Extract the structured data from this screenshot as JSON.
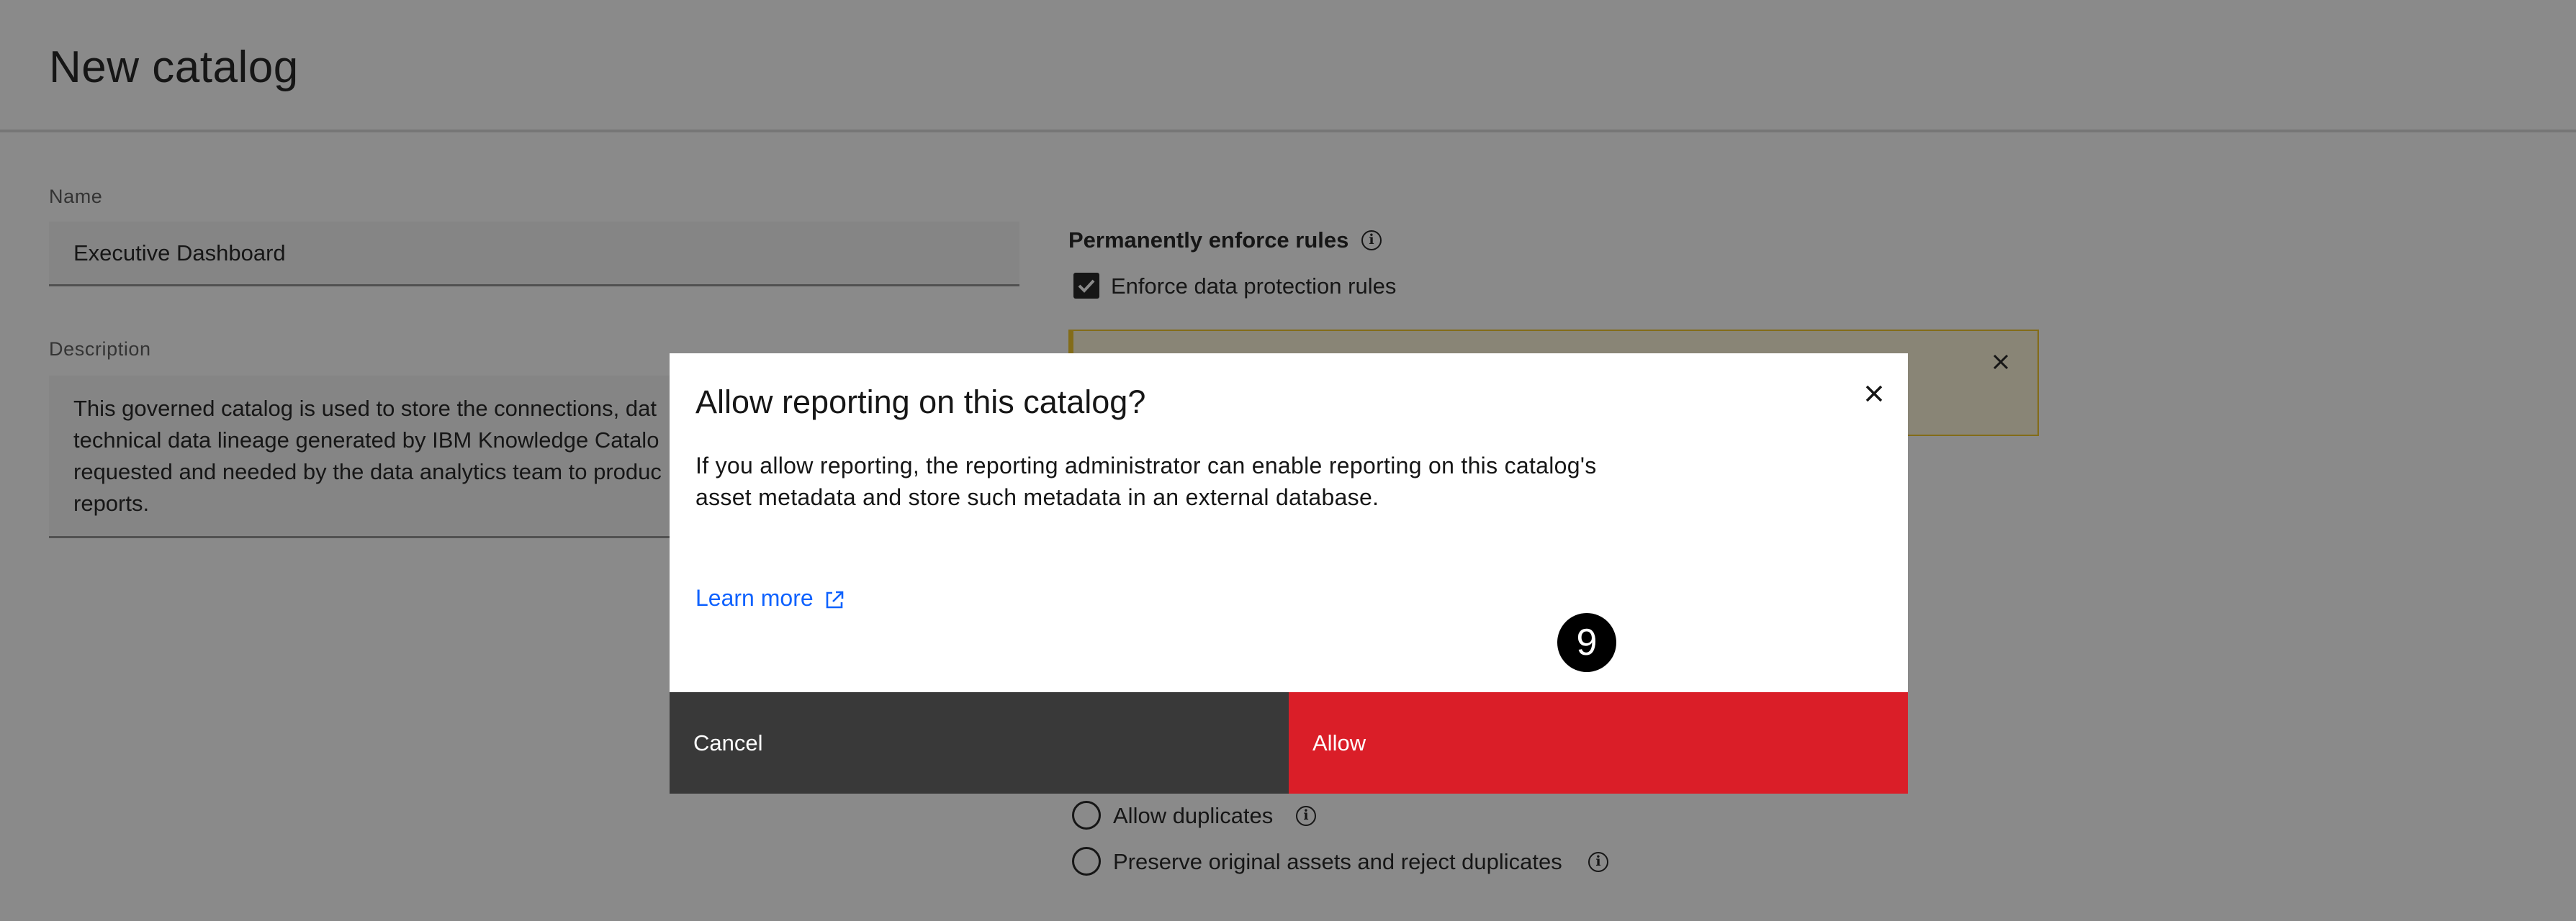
{
  "header": {
    "title": "New catalog"
  },
  "form": {
    "name_label": "Name",
    "name_value": "Executive Dashboard",
    "description_label": "Description",
    "description_lines": [
      "This governed catalog is used to store the connections, dat",
      "technical data lineage generated by IBM Knowledge Catalo",
      "requested and needed by the data analytics team to produc",
      "reports."
    ]
  },
  "rules": {
    "title": "Permanently enforce rules",
    "enforce_label": "Enforce data protection rules",
    "enforce_checked": true
  },
  "duplicates": {
    "allow_label": "Allow duplicates",
    "preserve_label": "Preserve original assets and reject duplicates"
  },
  "modal": {
    "title": "Allow reporting on this catalog?",
    "body_line1": "If you allow reporting, the reporting administrator can enable reporting on this catalog's",
    "body_line2": "asset metadata and store such metadata in an external database.",
    "learn_more": "Learn more",
    "cancel_label": "Cancel",
    "allow_label": "Allow",
    "step_badge": "9"
  },
  "colors": {
    "primary_button": "#da1e28",
    "secondary_button": "#393939",
    "link": "#0f62fe",
    "warning_border": "#f1c21b"
  },
  "icons": {
    "info": "info-icon",
    "close": "close-icon",
    "external_link": "external-link-icon",
    "checkmark": "checkmark-icon"
  }
}
